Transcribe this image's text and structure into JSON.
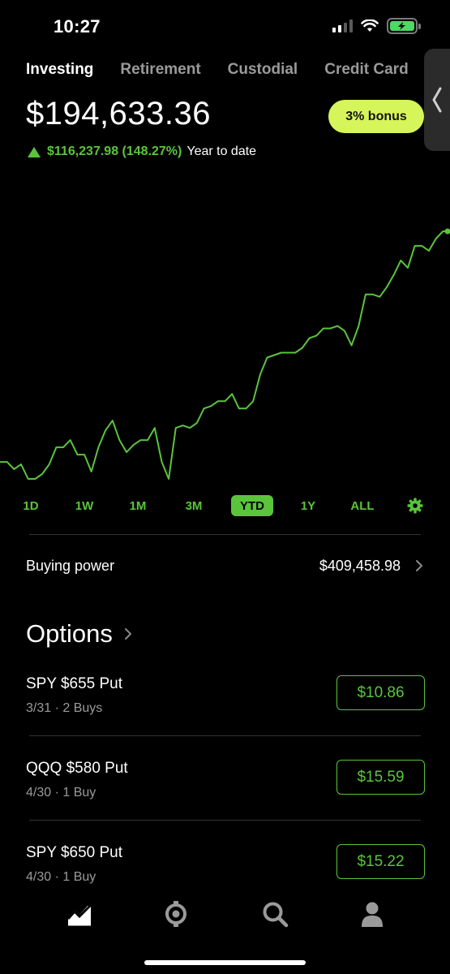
{
  "status_bar": {
    "time": "10:27"
  },
  "tabs": [
    {
      "label": "Investing",
      "active": true
    },
    {
      "label": "Retirement",
      "active": false
    },
    {
      "label": "Custodial",
      "active": false
    },
    {
      "label": "Credit Card",
      "active": false
    }
  ],
  "portfolio": {
    "value": "$194,633.36",
    "bonus_label": "3% bonus",
    "change": "$116,237.98 (148.27%)",
    "change_period": "Year to date",
    "accent_color": "#5ac53b"
  },
  "chart_data": {
    "type": "line",
    "color": "#5ac53b",
    "values": [
      61,
      61,
      64,
      62,
      68,
      68,
      66,
      62,
      55,
      55,
      52,
      58,
      58,
      65,
      55,
      48,
      44,
      52,
      57,
      54,
      52,
      52,
      47,
      61,
      68,
      47,
      46,
      47,
      45,
      39,
      38,
      36,
      36,
      33,
      39,
      39,
      36,
      25,
      18,
      17,
      16,
      16,
      16,
      14,
      10,
      9,
      6,
      6,
      5,
      7,
      13,
      5,
      -8,
      -8,
      -7,
      -11,
      -16,
      -22,
      -19,
      -28,
      -28,
      -26,
      -31,
      -34,
      -34
    ]
  },
  "ranges": [
    {
      "label": "1D",
      "active": false
    },
    {
      "label": "1W",
      "active": false
    },
    {
      "label": "1M",
      "active": false
    },
    {
      "label": "3M",
      "active": false
    },
    {
      "label": "YTD",
      "active": true
    },
    {
      "label": "1Y",
      "active": false
    },
    {
      "label": "ALL",
      "active": false
    }
  ],
  "buying_power": {
    "label": "Buying power",
    "value": "$409,458.98"
  },
  "options": {
    "title": "Options",
    "items": [
      {
        "name": "SPY $655 Put",
        "detail": "3/31 · 2 Buys",
        "price": "$10.86"
      },
      {
        "name": "QQQ $580 Put",
        "detail": "4/30 · 1 Buy",
        "price": "$15.59"
      },
      {
        "name": "SPY $650 Put",
        "detail": "4/30 · 1 Buy",
        "price": "$15.22"
      }
    ]
  },
  "bottom_nav": [
    {
      "icon": "chart-icon",
      "active": true
    },
    {
      "icon": "crypto-icon",
      "active": false
    },
    {
      "icon": "search-icon",
      "active": false
    },
    {
      "icon": "account-icon",
      "active": false
    }
  ]
}
